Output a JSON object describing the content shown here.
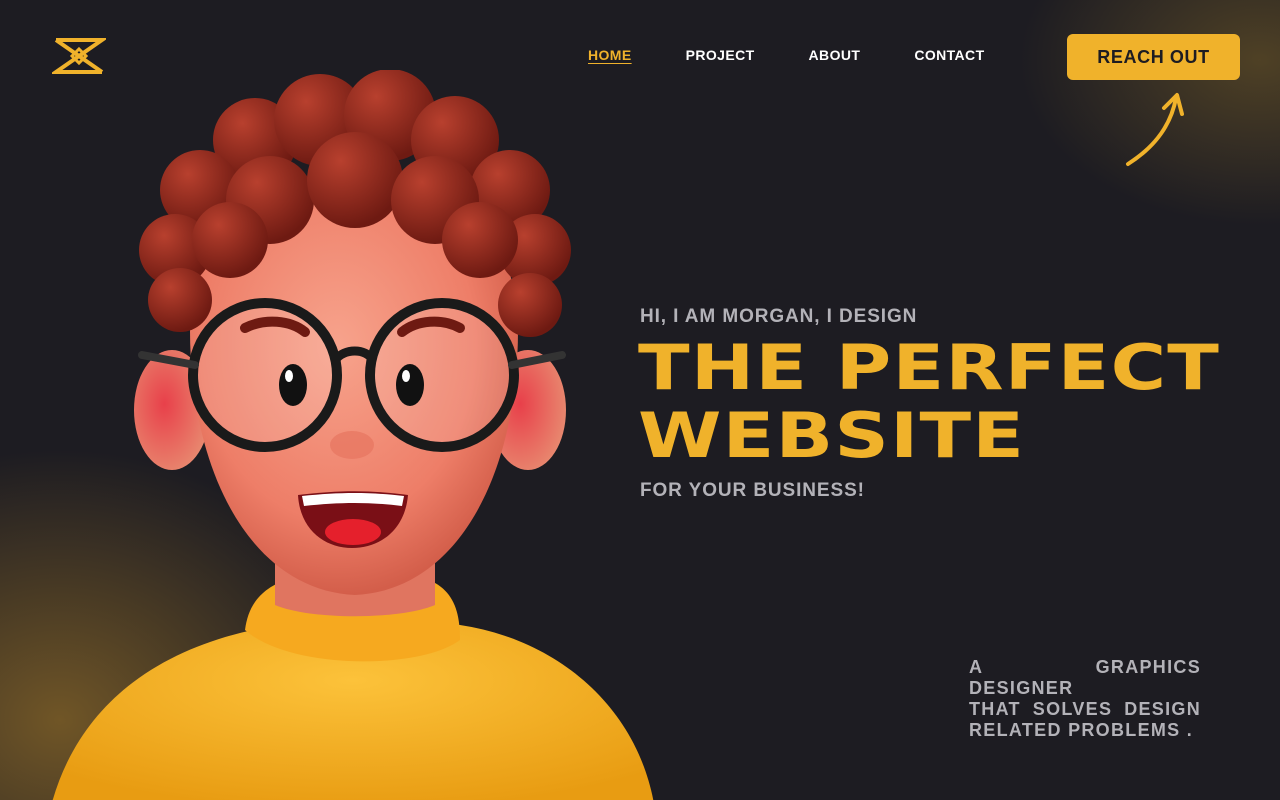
{
  "nav": {
    "items": [
      {
        "label": "HOME",
        "active": true
      },
      {
        "label": "PROJECT",
        "active": false
      },
      {
        "label": "ABOUT",
        "active": false
      },
      {
        "label": "CONTACT",
        "active": false
      }
    ],
    "cta_label": "REACH OUT"
  },
  "hero": {
    "eyebrow": "HI, I AM MORGAN, I DESIGN",
    "headline_line1": "THE PERFECT",
    "headline_line2": "WEBSITE",
    "subline": "FOR YOUR BUSINESS!",
    "tagline": [
      "A GRAPHICS DESIGNER",
      "THAT SOLVES DESIGN",
      "RELATED PROBLEMS ."
    ]
  },
  "colors": {
    "background": "#1d1c22",
    "accent": "#f0b22b",
    "muted_text": "#b3b2b8"
  },
  "icons": {
    "logo": "logo-mark",
    "pointer": "curved-arrow-icon"
  }
}
